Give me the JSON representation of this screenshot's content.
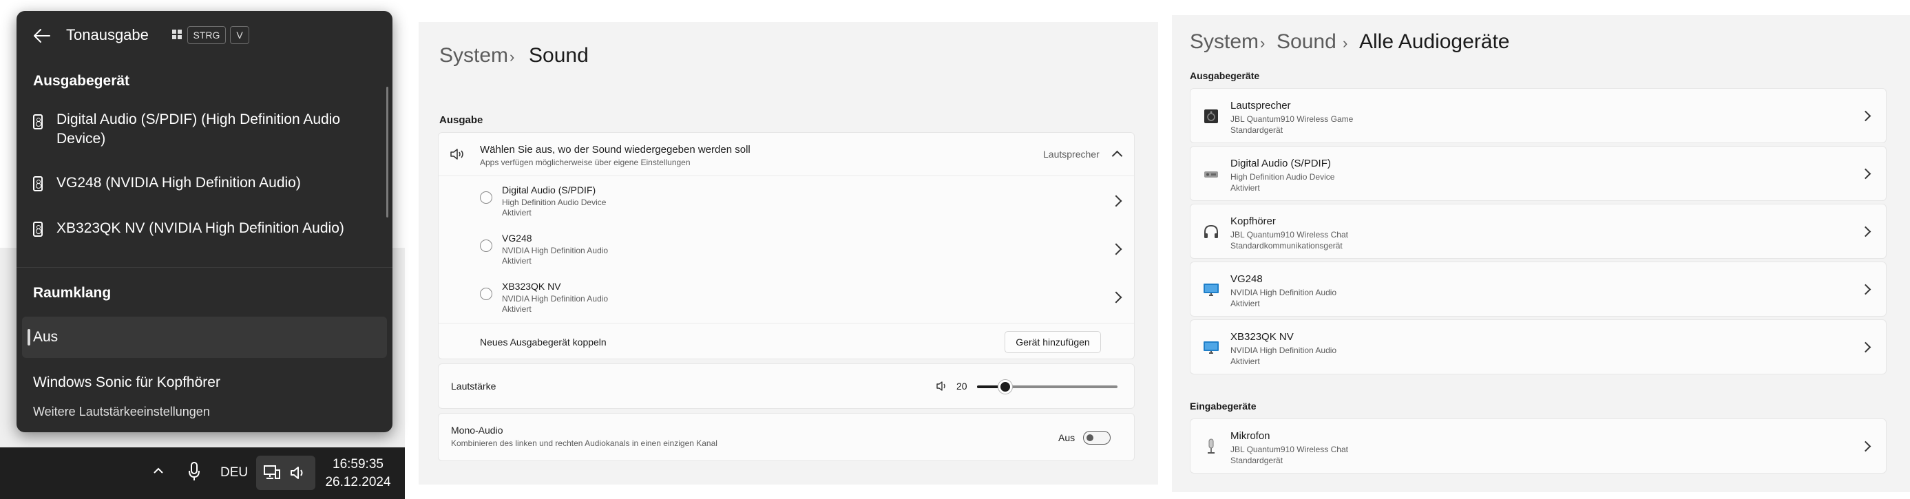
{
  "flyout": {
    "title": "Tonausgabe",
    "shortcut_keys": [
      "STRG",
      "V"
    ],
    "output_section": "Ausgabegerät",
    "devices": [
      "Digital Audio (S/PDIF) (High Definition Audio Device)",
      "VG248 (NVIDIA High Definition Audio)",
      "XB323QK NV (NVIDIA High Definition Audio)"
    ],
    "spatial_section": "Raumklang",
    "spatial_options": [
      "Aus",
      "Windows Sonic für Kopfhörer"
    ],
    "selected_spatial": "Aus",
    "footer": "Weitere Lautstärkeeinstellungen"
  },
  "taskbar": {
    "language": "DEU",
    "time": "16:59:35",
    "date": "26.12.2024"
  },
  "sound": {
    "breadcrumb": [
      "System",
      "Sound"
    ],
    "output_title": "Ausgabe",
    "choose_label": "Wählen Sie aus, wo der Sound wiedergegeben werden soll",
    "choose_sub": "Apps verfügen möglicherweise über eigene Einstellungen",
    "current_output": "Lautsprecher",
    "outputs": [
      {
        "name": "Digital Audio (S/PDIF)",
        "desc": "High Definition Audio Device",
        "status": "Aktiviert"
      },
      {
        "name": "VG248",
        "desc": "NVIDIA High Definition Audio",
        "status": "Aktiviert"
      },
      {
        "name": "XB323QK NV",
        "desc": "NVIDIA High Definition Audio",
        "status": "Aktiviert"
      }
    ],
    "pair_label": "Neues Ausgabegerät koppeln",
    "add_device_button": "Gerät hinzufügen",
    "volume_label": "Lautstärke",
    "volume_value": "20",
    "volume_fraction": 0.2,
    "mono_label": "Mono-Audio",
    "mono_sub": "Kombinieren des linken und rechten Audiokanals in einen einzigen Kanal",
    "mono_state": "Aus"
  },
  "devices_page": {
    "breadcrumb": [
      "System",
      "Sound",
      "Alle Audiogeräte"
    ],
    "output_title": "Ausgabegeräte",
    "outputs": [
      {
        "name": "Lautsprecher",
        "desc": "JBL Quantum910 Wireless Game",
        "status": "Standardgerät",
        "icon": "speaker-box-icon"
      },
      {
        "name": "Digital Audio (S/PDIF)",
        "desc": "High Definition Audio Device",
        "status": "Aktiviert",
        "icon": "digital-audio-icon"
      },
      {
        "name": "Kopfhörer",
        "desc": "JBL Quantum910 Wireless Chat",
        "status": "Standardkommunikationsgerät",
        "icon": "headphones-icon"
      },
      {
        "name": "VG248",
        "desc": "NVIDIA High Definition Audio",
        "status": "Aktiviert",
        "icon": "monitor-icon"
      },
      {
        "name": "XB323QK NV",
        "desc": "NVIDIA High Definition Audio",
        "status": "Aktiviert",
        "icon": "monitor-icon"
      }
    ],
    "input_title": "Eingabegeräte",
    "inputs": [
      {
        "name": "Mikrofon",
        "desc": "JBL Quantum910 Wireless Chat",
        "status": "Standardgerät",
        "icon": "microphone-icon"
      }
    ]
  },
  "colors": {
    "flyout_bg": "#2b2b2b",
    "taskbar_bg": "#1f1f1f",
    "settings_bg": "#f3f3f3",
    "card_bg": "#fbfbfb",
    "monitor_blue": "#1f7fc9"
  }
}
